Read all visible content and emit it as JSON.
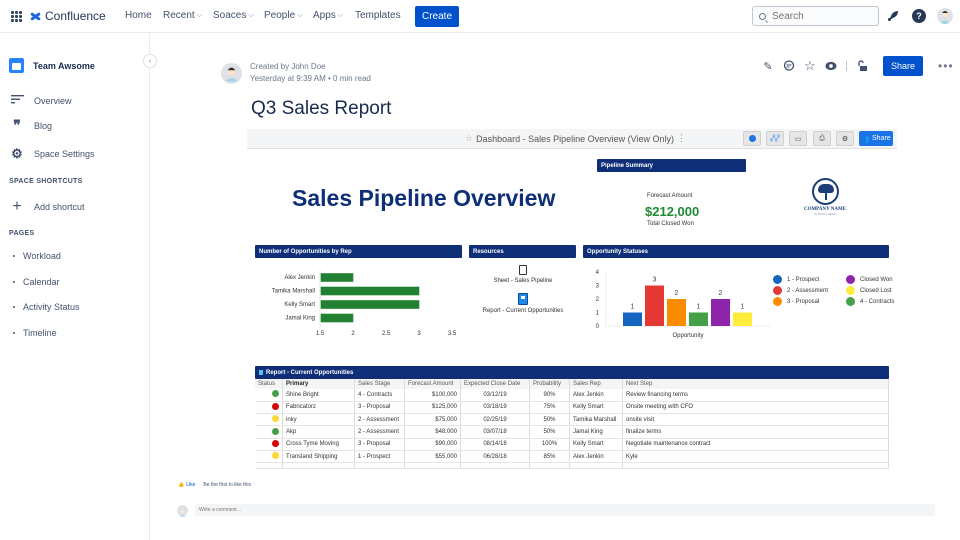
{
  "topnav": {
    "app_name": "Confluence",
    "items": [
      {
        "label": "Home",
        "dropdown": false
      },
      {
        "label": "Recent",
        "dropdown": true
      },
      {
        "label": "Soaces",
        "dropdown": true
      },
      {
        "label": "People",
        "dropdown": true
      },
      {
        "label": "Apps",
        "dropdown": true
      },
      {
        "label": "Templates",
        "dropdown": false
      }
    ],
    "create_label": "Create",
    "search_placeholder": "Search",
    "help_glyph": "?"
  },
  "sidebar": {
    "space_name": "Team Awsome",
    "links": [
      {
        "label": "Overview",
        "icon": "overview-icon"
      },
      {
        "label": "Blog",
        "icon": "quote-icon"
      },
      {
        "label": "Space Settings",
        "icon": "gear-icon"
      }
    ],
    "shortcuts_heading": "SPACE SHORTCUTS",
    "add_shortcut": "Add shortcut",
    "pages_heading": "PAGES",
    "pages": [
      "Workload",
      "Calendar",
      "Activity Status",
      "Timeline"
    ],
    "collapse_glyph": "‹"
  },
  "page": {
    "created_by": "Created by John Doe",
    "timestamp": "Yesterday at 9:39 AM",
    "read_time": "0 min read",
    "title": "Q3 Sales Report",
    "share_label": "Share",
    "more_glyph": "•••"
  },
  "dashboard": {
    "bar_title": "Dashboard - Sales Pipeline Overview (View Only)",
    "share_label": "Share",
    "heading": "Sales Pipeline Overview",
    "pipeline_summary": {
      "header": "Pipeline Summary",
      "label": "Forecast Amount",
      "value": "$212,000",
      "sub": "Total Closed Won"
    },
    "company": {
      "name": "COMPANY NAME",
      "slogan": "SLOGAN HERE"
    },
    "resources": {
      "header": "Resources",
      "items": [
        "Sheet - Sales Pipeline",
        "Report - Current Opportunities"
      ]
    }
  },
  "chart_data": [
    {
      "type": "bar",
      "orientation": "horizontal",
      "title": "Number of Opportunities by Rep",
      "categories": [
        "Alex Jenkin",
        "Tamika Marshall",
        "Kelly Smart",
        "Jamal King"
      ],
      "values": [
        2,
        3,
        3,
        2
      ],
      "xlim": [
        1.5,
        3.5
      ],
      "xticks": [
        "1.5",
        "2",
        "2.5",
        "3",
        "3.5"
      ],
      "color": "#218032",
      "grid": false
    },
    {
      "type": "bar",
      "title": "Opportunity Statuses",
      "xlabel": "Opportunity",
      "ylim": [
        0,
        4
      ],
      "yticks": [
        "0",
        "1",
        "2",
        "3",
        "4"
      ],
      "series": [
        {
          "name": "1 - Prospect",
          "value": 1,
          "color": "#1565c0"
        },
        {
          "name": "2 - Assessment",
          "value": 3,
          "color": "#e53935"
        },
        {
          "name": "3 - Proposal",
          "value": 2,
          "color": "#fb8c00"
        },
        {
          "name": "4 - Contracts",
          "value": 1,
          "color": "#43a047"
        },
        {
          "name": "Closed Won",
          "value": 2,
          "color": "#8e24aa"
        },
        {
          "name": "Closed Lost",
          "value": 1,
          "color": "#ffeb3b"
        }
      ],
      "legend": "right",
      "grid": false
    }
  ],
  "report": {
    "header": "Report - Current Opportunities",
    "columns": [
      "Status",
      "Primary",
      "Sales Stage",
      "Forecast Amount",
      "Expected Close Date",
      "Probability",
      "Sales Rep",
      "Next Step"
    ],
    "rows": [
      {
        "status": "#43a047",
        "primary": "Shine Bright",
        "stage": "4 - Contracts",
        "amount": "$100,000",
        "date": "03/12/19",
        "prob": "90%",
        "rep": "Alex Jenkin",
        "next": "Review financing terms"
      },
      {
        "status": "#d50000",
        "primary": "Fabricatorz",
        "stage": "3 - Proposal",
        "amount": "$125,000",
        "date": "03/18/19",
        "prob": "75%",
        "rep": "Kelly Smart",
        "next": "Onsite meeting with CFO"
      },
      {
        "status": "#fdd835",
        "primary": "inky",
        "stage": "2 - Assessment",
        "amount": "$75,000",
        "date": "02/25/19",
        "prob": "50%",
        "rep": "Tamika Marshall",
        "next": "onsite visit"
      },
      {
        "status": "#43a047",
        "primary": "Akp",
        "stage": "2 - Assessment",
        "amount": "$48,000",
        "date": "03/07/18",
        "prob": "50%",
        "rep": "Jamal King",
        "next": "finalize terms"
      },
      {
        "status": "#d50000",
        "primary": "Cross Tyme Moving",
        "stage": "3 - Proposal",
        "amount": "$90,000",
        "date": "08/14/18",
        "prob": "100%",
        "rep": "Kelly Smart",
        "next": "Negotiate maintenance contract"
      },
      {
        "status": "#fdd835",
        "primary": "Transland Shipping",
        "stage": "1 - Prospect",
        "amount": "$55,000",
        "date": "06/28/18",
        "prob": "85%",
        "rep": "Alex Jenkin",
        "next": "Kyle"
      }
    ]
  },
  "footer": {
    "like_label": "Like",
    "like_text": "Be the first to like this",
    "comment_placeholder": "Write a comment..."
  }
}
